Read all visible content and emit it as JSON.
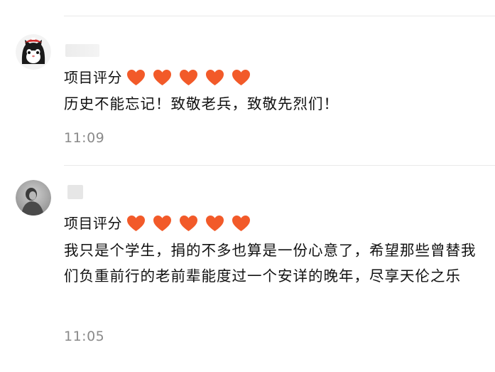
{
  "comments": [
    {
      "avatar_icon": "cat-avatar-icon",
      "rating_label": "项目评分",
      "rating_hearts": 5,
      "text": "历史不能忘记！致敬老兵，致敬先烈们！",
      "time": "11:09"
    },
    {
      "avatar_icon": "person-avatar-icon",
      "rating_label": "项目评分",
      "rating_hearts": 5,
      "text": "我只是个学生，捐的不多也算是一份心意了，希望那些曾替我们负重前行的老前辈能度过一个安详的晚年，尽享天伦之乐",
      "time": "11:05"
    }
  ],
  "colors": {
    "heart": "#f25a29",
    "timestamp": "#8a8a8a",
    "divider": "#e9e9e9"
  }
}
